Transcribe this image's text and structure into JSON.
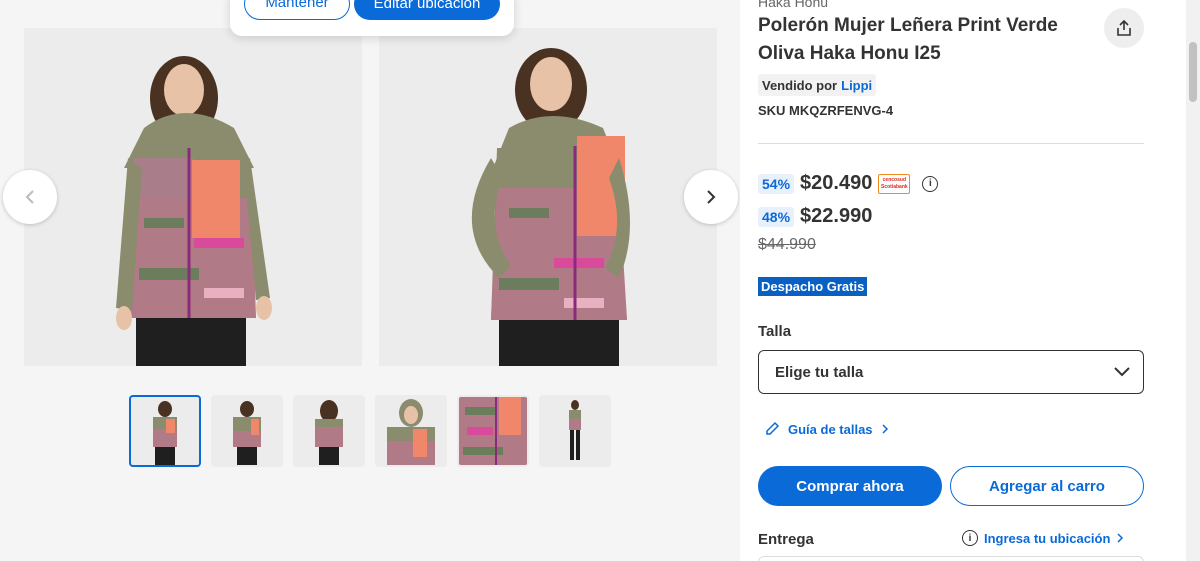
{
  "popup": {
    "keep_label": "Mantener",
    "edit_label": "Editar ubicación"
  },
  "product": {
    "brand": "Haka Honu",
    "title": "Polerón Mujer Leñera Print Verde Oliva Haka Honu I25",
    "seller_prefix": "Vendido por",
    "seller_name": "Lippi",
    "sku": "SKU MKQZRFENVG-4"
  },
  "prices": {
    "cmr": {
      "discount": "54%",
      "amount": "$20.490",
      "badge_text": "cencosud Scotiabank"
    },
    "internet": {
      "discount": "48%",
      "amount": "$22.990"
    },
    "normal": {
      "amount": "$44.990"
    }
  },
  "shipping_badge": "Despacho Gratis",
  "size": {
    "label": "Talla",
    "placeholder": "Elige tu talla",
    "guide_label": "Guía de tallas"
  },
  "actions": {
    "buy_label": "Comprar ahora",
    "cart_label": "Agregar al carro"
  },
  "delivery": {
    "label": "Entrega",
    "location_link": "Ingresa tu ubicación"
  },
  "gallery": {
    "thumbnail_count": 6,
    "active_index": 0
  },
  "colors": {
    "accent": "#0a6ad8",
    "jacket_olive": "#8b8c6e",
    "panel_coral": "#f0876a",
    "print_pink": "#c86a8e"
  }
}
